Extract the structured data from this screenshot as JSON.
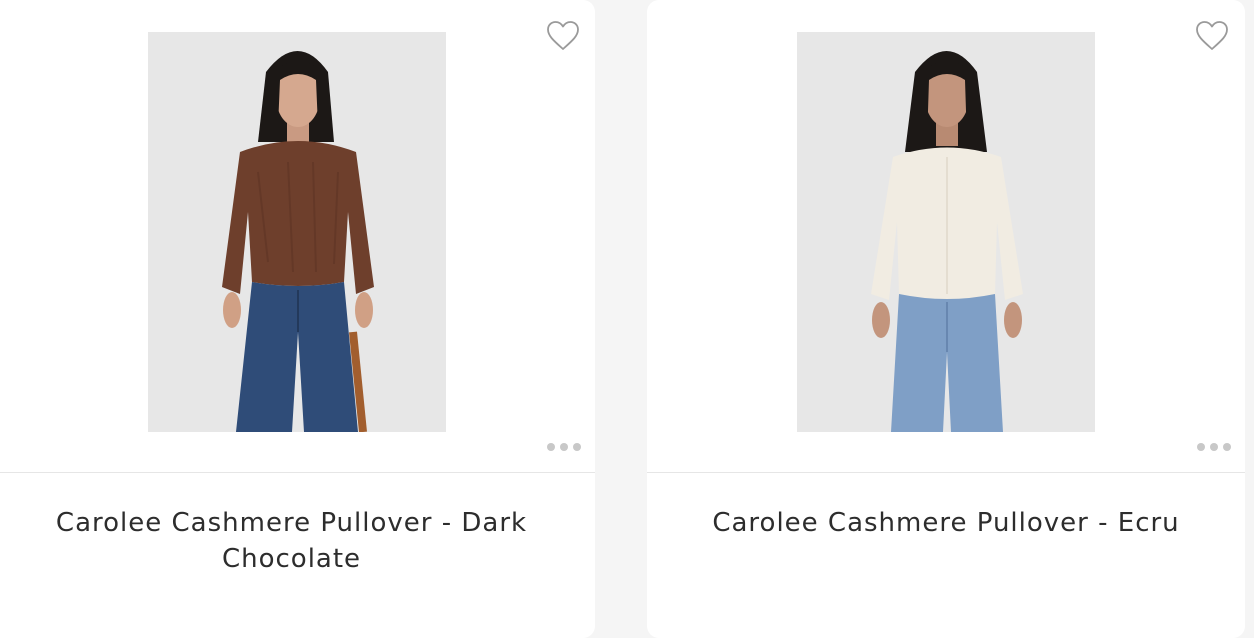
{
  "products": [
    {
      "title": "Carolee Cashmere Pullover - Dark Chocolate",
      "image_alt": "Model wearing dark chocolate fuzzy cashmere pullover with blue jeans",
      "sweater_color": "#6e3f2c",
      "jeans_color": "#2f4c78",
      "favorite_icon": "heart-outline-icon",
      "more_icon": "ellipsis-icon"
    },
    {
      "title": "Carolee Cashmere Pullover - Ecru",
      "image_alt": "Model wearing ecru cashmere pullover with light wash jeans",
      "sweater_color": "#f1ece2",
      "jeans_color": "#7f9fc6",
      "favorite_icon": "heart-outline-icon",
      "more_icon": "ellipsis-icon"
    }
  ],
  "colors": {
    "page_background": "#f5f5f5",
    "card_background": "#ffffff",
    "photo_background": "#e7e7e7",
    "title_text": "#2d2d2d",
    "icon_gray": "#c8c8c8"
  }
}
